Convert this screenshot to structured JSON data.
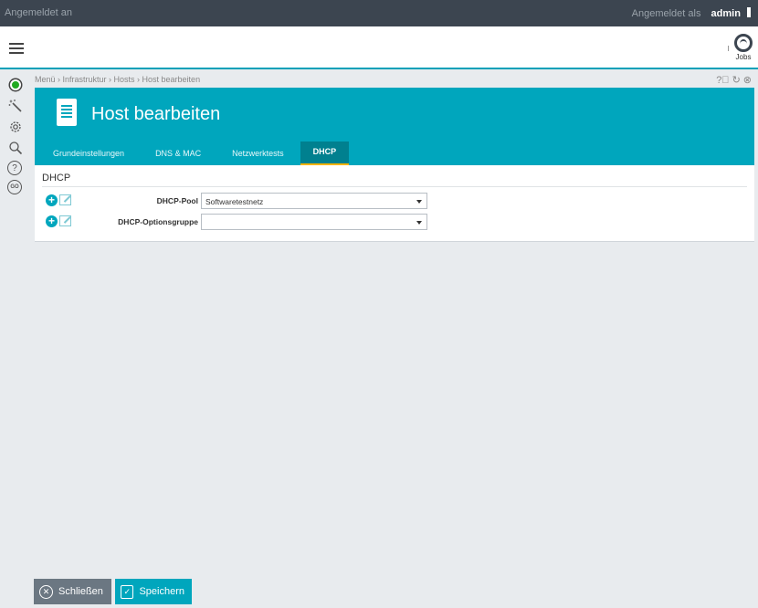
{
  "topbar": {
    "login_status": "Angemeldet an",
    "logged_as_label": "Angemeldet als",
    "username": "admin"
  },
  "header": {
    "jobs_label": "Jobs"
  },
  "sidebar": {
    "icons": [
      "status-icon",
      "wizard-icon",
      "gear-icon",
      "search-icon",
      "help-icon",
      "go-icon"
    ]
  },
  "breadcrumb": "Menü › Infrastruktur › Hosts › Host bearbeiten",
  "page": {
    "title": "Host bearbeiten",
    "tabs": [
      {
        "label": "Grundeinstellungen",
        "active": false
      },
      {
        "label": "DNS & MAC",
        "active": false
      },
      {
        "label": "Netzwerktests",
        "active": false
      },
      {
        "label": "DHCP",
        "active": true
      }
    ]
  },
  "section": {
    "title": "DHCP",
    "fields": [
      {
        "label": "DHCP-Pool",
        "value": "Softwaretestnetz"
      },
      {
        "label": "DHCP-Optionsgruppe",
        "value": ""
      }
    ]
  },
  "buttons": {
    "close_label": "Schließen",
    "save_label": "Speichern"
  },
  "colors": {
    "accent": "#00a6bd",
    "topbar": "#3c4550",
    "active_tab": "#00808f",
    "tab_underline": "#f5b400",
    "status": "#22aa22"
  }
}
